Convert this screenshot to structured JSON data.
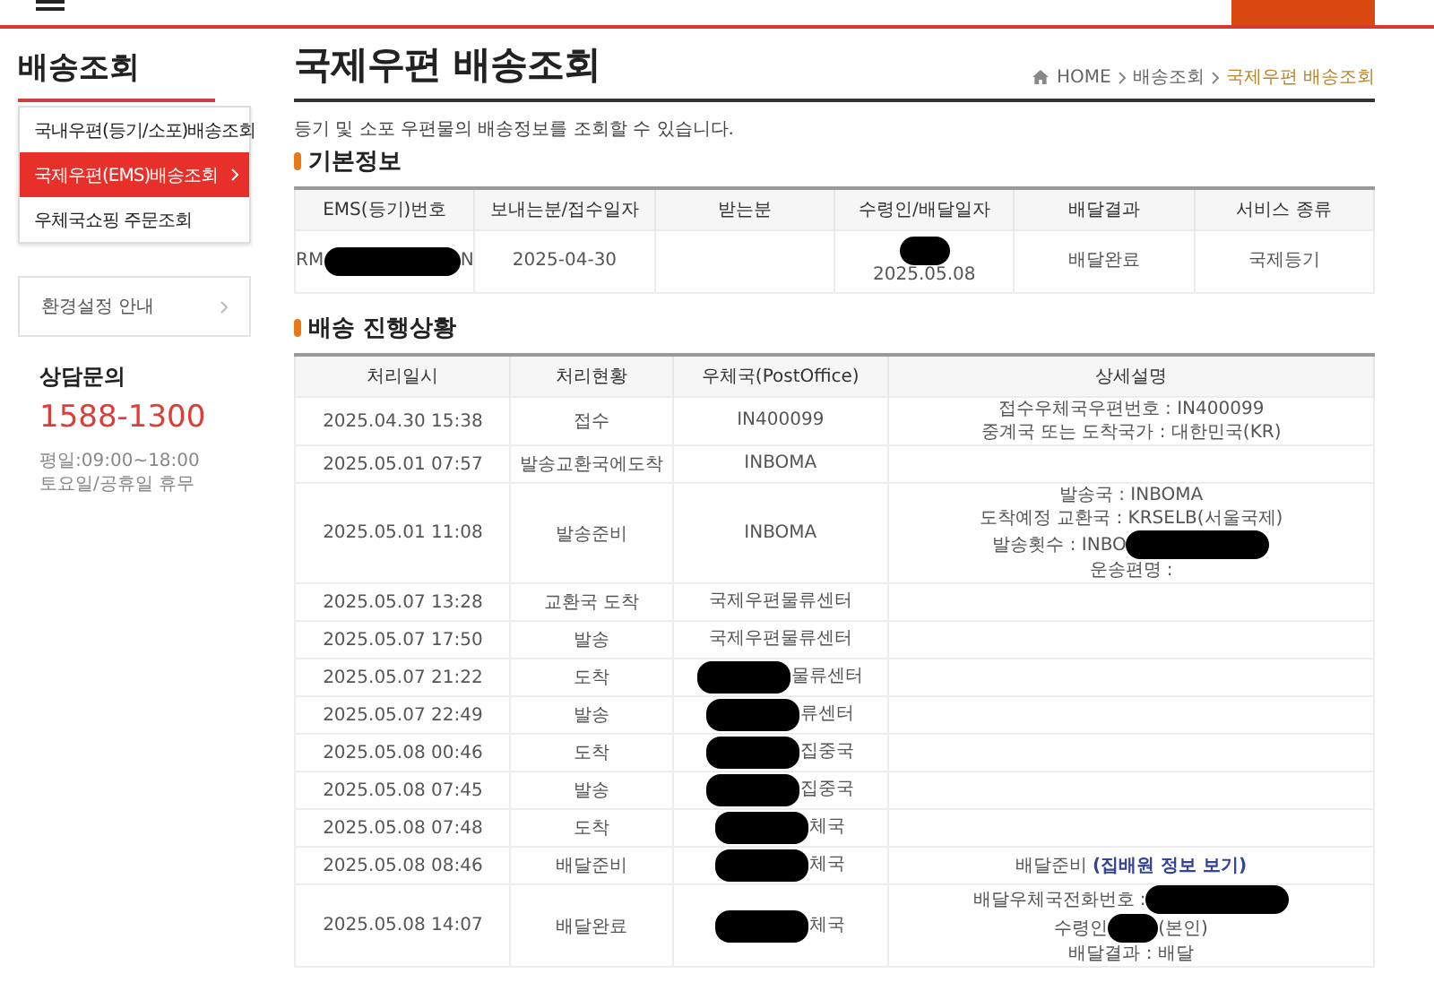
{
  "sidebar": {
    "title": "배송조회",
    "menu": [
      {
        "label": "국내우편(등기/소포)배송조회",
        "selected": false
      },
      {
        "label": "국제우편(EMS)배송조회",
        "selected": true
      },
      {
        "label": "우체국쇼핑 주문조회",
        "selected": false
      }
    ],
    "settings_link": "환경설정 안내",
    "contact": {
      "title": "상담문의",
      "phone": "1588-1300",
      "hours": [
        "평일:09:00~18:00",
        "토요일/공휴일 휴무"
      ]
    }
  },
  "page": {
    "title": "국제우편 배송조회",
    "breadcrumb": [
      "HOME",
      "배송조회",
      "국제우편 배송조회"
    ],
    "description": "등기 및 소포 우편물의 배송정보를 조회할 수 있습니다."
  },
  "basic_info": {
    "heading": "기본정보",
    "columns": [
      "EMS(등기)번호",
      "보내는분/접수일자",
      "받는분",
      "수령인/배달일자",
      "배달결과",
      "서비스 종류"
    ],
    "row": {
      "ems_number": [
        [
          {
            "kind": "text",
            "text": "RM"
          },
          {
            "kind": "redaction"
          },
          {
            "kind": "text",
            "text": "N"
          }
        ]
      ],
      "sender_date": [
        [
          {
            "kind": "text",
            "text": "2025-04-30"
          }
        ]
      ],
      "recipient_date": [
        [
          {
            "kind": "redaction_small"
          }
        ],
        [
          {
            "kind": "text",
            "text": "2025.05.08"
          }
        ]
      ],
      "result": [
        [
          {
            "kind": "text",
            "text": "배달완료"
          }
        ]
      ],
      "service": [
        [
          {
            "kind": "text",
            "text": "국제등기"
          }
        ]
      ]
    }
  },
  "progress": {
    "heading": "배송 진행상황",
    "columns": [
      "처리일시",
      "처리현황",
      "우체국(PostOffice)",
      "상세설명"
    ],
    "rows": [
      {
        "time": "2025.04.30 15:38",
        "status": "접수",
        "office": [
          {
            "kind": "text",
            "text": "IN400099"
          }
        ],
        "details": [
          [
            {
              "kind": "text",
              "text": "접수우체국우편번호 : IN400099"
            }
          ],
          [
            {
              "kind": "text",
              "text": "중계국 또는 도착국가 : 대한민국(KR)"
            }
          ]
        ]
      },
      {
        "time": "2025.05.01 07:57",
        "status": "발송교환국에도착",
        "office": [
          {
            "kind": "text",
            "text": "INBOMA"
          }
        ],
        "details": []
      },
      {
        "time": "2025.05.01 11:08",
        "status": "발송준비",
        "office": [
          {
            "kind": "text",
            "text": "INBOMA"
          }
        ],
        "details": [
          [
            {
              "kind": "text",
              "text": "발송국 : INBOMA"
            }
          ],
          [
            {
              "kind": "text",
              "text": "도착예정 교환국 : KRSELB(서울국제)"
            }
          ],
          [
            {
              "kind": "text",
              "text": "발송횟수 : INBO"
            },
            {
              "kind": "redaction"
            }
          ],
          [
            {
              "kind": "text",
              "text": "운송편명 :"
            }
          ]
        ]
      },
      {
        "time": "2025.05.07 13:28",
        "status": "교환국 도착",
        "office": [
          {
            "kind": "text",
            "text": "국제우편물류센터"
          }
        ],
        "details": []
      },
      {
        "time": "2025.05.07 17:50",
        "status": "발송",
        "office": [
          {
            "kind": "text",
            "text": "국제우편물류센터"
          }
        ],
        "details": []
      },
      {
        "time": "2025.05.07 21:22",
        "status": "도착",
        "office": [
          {
            "kind": "redaction"
          },
          {
            "kind": "text",
            "text": "물류센터"
          }
        ],
        "details": []
      },
      {
        "time": "2025.05.07 22:49",
        "status": "발송",
        "office": [
          {
            "kind": "redaction"
          },
          {
            "kind": "text",
            "text": "류센터"
          }
        ],
        "details": []
      },
      {
        "time": "2025.05.08 00:46",
        "status": "도착",
        "office": [
          {
            "kind": "redaction"
          },
          {
            "kind": "text",
            "text": "집중국"
          }
        ],
        "details": []
      },
      {
        "time": "2025.05.08 07:45",
        "status": "발송",
        "office": [
          {
            "kind": "redaction"
          },
          {
            "kind": "text",
            "text": "집중국"
          }
        ],
        "details": []
      },
      {
        "time": "2025.05.08 07:48",
        "status": "도착",
        "office": [
          {
            "kind": "redaction"
          },
          {
            "kind": "text",
            "text": "체국"
          }
        ],
        "details": []
      },
      {
        "time": "2025.05.08 08:46",
        "status": "배달준비",
        "office": [
          {
            "kind": "redaction"
          },
          {
            "kind": "text",
            "text": "체국"
          }
        ],
        "details": [
          [
            {
              "kind": "text",
              "text": "배달준비"
            },
            {
              "kind": "link",
              "text": "(집배원 정보 보기)"
            }
          ]
        ]
      },
      {
        "time": "2025.05.08 14:07",
        "status": "배달완료",
        "office": [
          {
            "kind": "redaction"
          },
          {
            "kind": "text",
            "text": "체국"
          }
        ],
        "details": [
          [
            {
              "kind": "text",
              "text": "배달우체국전화번호 :"
            },
            {
              "kind": "redaction"
            }
          ],
          [
            {
              "kind": "text",
              "text": "수령인"
            },
            {
              "kind": "redaction_small"
            },
            {
              "kind": "text",
              "text": "(본인)"
            }
          ],
          [
            {
              "kind": "text",
              "text": "배달결과 : 배달"
            }
          ]
        ]
      }
    ]
  }
}
